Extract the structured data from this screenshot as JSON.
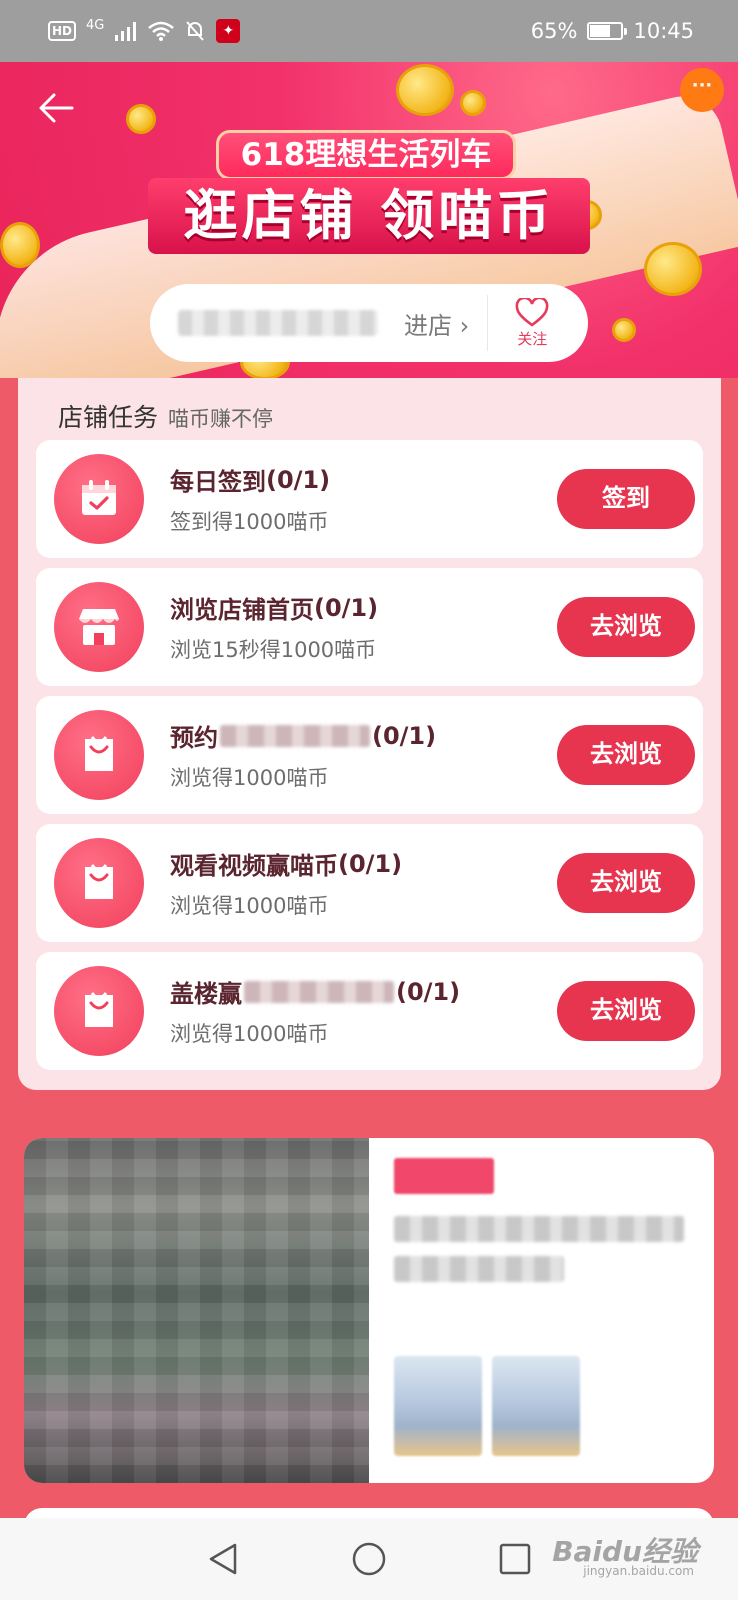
{
  "status_bar": {
    "network_badge": "HD",
    "signal": "4G",
    "battery_percent": "65%",
    "battery_level": 0.65,
    "time": "10:45"
  },
  "banner": {
    "subtitle": "618理想生活列车",
    "title": "逛店铺 领喵币",
    "more_icon": "more-icon",
    "back_icon": "back-arrow-icon",
    "colors": {
      "primary": "#e8245a",
      "accent": "#ff7a12"
    }
  },
  "shop_bar": {
    "enter_label": "进店",
    "follow_label": "关注"
  },
  "tasks_panel": {
    "title": "店铺任务",
    "subtitle": "喵币赚不停",
    "tasks": [
      {
        "title": "每日签到",
        "progress": "(0/1)",
        "desc": "签到得1000喵币",
        "button": "签到",
        "icon": "calendar-check-icon"
      },
      {
        "title": "浏览店铺首页",
        "progress": "(0/1)",
        "desc": "浏览15秒得1000喵币",
        "button": "去浏览",
        "icon": "storefront-icon"
      },
      {
        "title": "预约",
        "progress": "(0/1)",
        "desc": "浏览得1000喵币",
        "button": "去浏览",
        "icon": "shopping-bag-icon"
      },
      {
        "title": "观看视频赢喵币",
        "progress": "(0/1)",
        "desc": "浏览得1000喵币",
        "button": "去浏览",
        "icon": "shopping-bag-icon"
      },
      {
        "title": "盖楼赢",
        "progress": "(0/1)",
        "desc": "浏览得1000喵币",
        "button": "去浏览",
        "icon": "shopping-bag-icon"
      }
    ],
    "colors": {
      "button": "#e7344f",
      "icon_bg": "#f2405c"
    }
  },
  "watermark": {
    "text": "Baidu经验",
    "sub": "jingyan.baidu.com"
  },
  "nav": {
    "back_icon": "nav-back-icon",
    "home_icon": "nav-home-icon",
    "recent_icon": "nav-recent-icon"
  }
}
